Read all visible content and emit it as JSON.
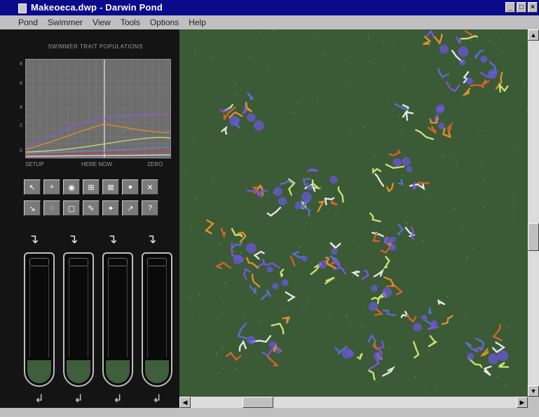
{
  "window": {
    "title": "Makeoeca.dwp - Darwin Pond",
    "buttons": {
      "minimize": "_",
      "maximize": "□",
      "close": "×"
    }
  },
  "menu": [
    "Pond",
    "Swimmer",
    "View",
    "Tools",
    "Options",
    "Help"
  ],
  "graph": {
    "title": "SWIMMER TRAIT POPULATIONS",
    "y_ticks": [
      "8",
      "6",
      "4",
      "2",
      "0"
    ],
    "x_left_label": "SETUP",
    "x_mid_label": "HERE NOW",
    "x_right_label": "ZERO",
    "line_colors": [
      "#8a5bd6",
      "#e0902a",
      "#c8e070",
      "#5a8ad6",
      "#d03a3a",
      "#e6e6e6"
    ]
  },
  "tools": {
    "row1": [
      {
        "name": "select-tool",
        "glyph": "↖"
      },
      {
        "name": "add-swimmer-tool",
        "glyph": "+"
      },
      {
        "name": "food-tool",
        "glyph": "◉"
      },
      {
        "name": "zoom-tool",
        "glyph": "⊞"
      },
      {
        "name": "probe-tool",
        "glyph": "⊠"
      },
      {
        "name": "blob-tool",
        "glyph": "●"
      },
      {
        "name": "kill-tool",
        "glyph": "✕"
      }
    ],
    "row2": [
      {
        "name": "move-tool",
        "glyph": "↘"
      },
      {
        "name": "lasso-tool",
        "glyph": "◌"
      },
      {
        "name": "box-tool",
        "glyph": "▢"
      },
      {
        "name": "inject-tool",
        "glyph": "✎"
      },
      {
        "name": "mutate-tool",
        "glyph": "✦"
      },
      {
        "name": "drag-tool",
        "glyph": "↗"
      },
      {
        "name": "info-tool",
        "glyph": "?"
      }
    ]
  },
  "tubes": [
    {
      "name": "tube-1",
      "level": 0.2
    },
    {
      "name": "tube-2",
      "level": 0.2
    },
    {
      "name": "tube-3",
      "level": 0.2
    },
    {
      "name": "tube-4",
      "level": 0.2
    }
  ],
  "pond": {
    "background": "#3b5a36",
    "swimmer_colors": [
      "#e0902a",
      "#7a55d8",
      "#5a6fd0",
      "#c8e070",
      "#e6e6e6",
      "#d6622a"
    ]
  }
}
